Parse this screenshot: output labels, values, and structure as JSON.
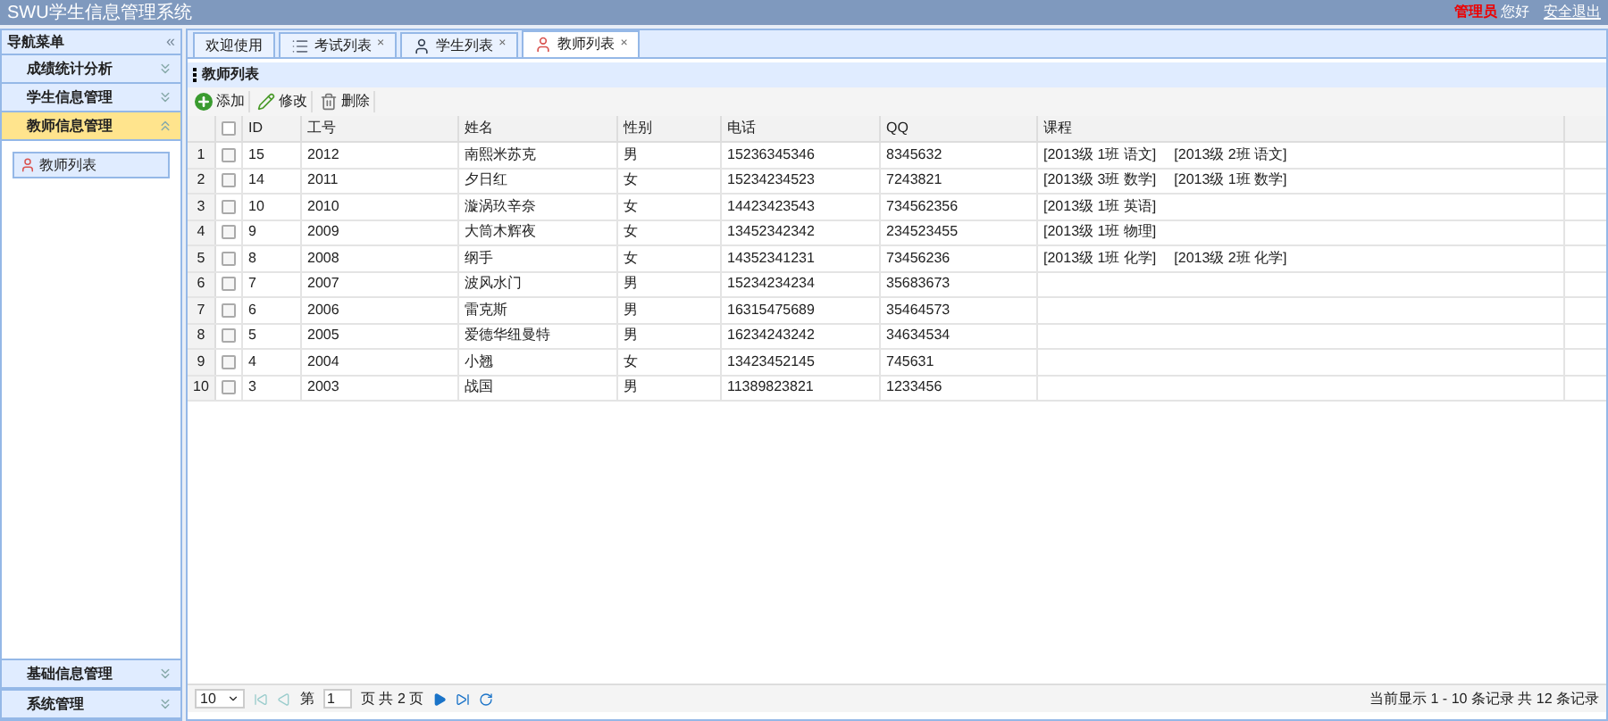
{
  "header": {
    "title": "SWU学生信息管理系统",
    "role": "管理员",
    "greeting": "您好",
    "logout": "安全退出"
  },
  "sidebar": {
    "title": "导航菜单",
    "collapse": "«",
    "items": [
      {
        "label": "成绩统计分析",
        "expanded": false
      },
      {
        "label": "学生信息管理",
        "expanded": false
      },
      {
        "label": "教师信息管理",
        "expanded": true,
        "children": [
          {
            "label": "教师列表"
          }
        ]
      }
    ],
    "bottom_items": [
      {
        "label": "基础信息管理",
        "expanded": false
      },
      {
        "label": "系统管理",
        "expanded": false
      }
    ]
  },
  "tabs": [
    {
      "label": "欢迎使用",
      "kind": "plain",
      "selected": false
    },
    {
      "label": "考试列表",
      "kind": "list",
      "close": "×",
      "selected": false
    },
    {
      "label": "学生列表",
      "kind": "student",
      "close": "×",
      "selected": false
    },
    {
      "label": "教师列表",
      "kind": "teacher",
      "close": "×",
      "selected": true
    }
  ],
  "panel": {
    "title": "教师列表"
  },
  "toolbar": [
    {
      "label": "添加",
      "kind": "add"
    },
    {
      "label": "修改",
      "kind": "edit"
    },
    {
      "label": "删除",
      "kind": "delete"
    }
  ],
  "table": {
    "all_checked": false,
    "columns": [
      "ID",
      "工号",
      "姓名",
      "性别",
      "电话",
      "QQ",
      "课程"
    ],
    "rows": [
      {
        "checked": false,
        "num": "1",
        "cells": [
          "15",
          "2012",
          "南熙米苏克",
          "男",
          "15236345346",
          "8345632"
        ],
        "courses": [
          "[2013级 1班 语文]",
          "[2013级 2班 语文]"
        ]
      },
      {
        "checked": false,
        "num": "2",
        "cells": [
          "14",
          "2011",
          "夕日红",
          "女",
          "15234234523",
          "7243821"
        ],
        "courses": [
          "[2013级 3班 数学]",
          "[2013级 1班 数学]"
        ]
      },
      {
        "checked": false,
        "num": "3",
        "cells": [
          "10",
          "2010",
          "漩涡玖辛奈",
          "女",
          "14423423543",
          "734562356"
        ],
        "courses": [
          "[2013级 1班 英语]"
        ]
      },
      {
        "checked": false,
        "num": "4",
        "cells": [
          "9",
          "2009",
          "大筒木辉夜",
          "女",
          "13452342342",
          "234523455"
        ],
        "courses": [
          "[2013级 1班 物理]"
        ]
      },
      {
        "checked": false,
        "num": "5",
        "cells": [
          "8",
          "2008",
          "纲手",
          "女",
          "14352341231",
          "73456236"
        ],
        "courses": [
          "[2013级 1班 化学]",
          "[2013级 2班 化学]"
        ]
      },
      {
        "checked": false,
        "num": "6",
        "cells": [
          "7",
          "2007",
          "波风水门",
          "男",
          "15234234234",
          "35683673"
        ],
        "courses": []
      },
      {
        "checked": false,
        "num": "7",
        "cells": [
          "6",
          "2006",
          "雷克斯",
          "男",
          "16315475689",
          "35464573"
        ],
        "courses": []
      },
      {
        "checked": false,
        "num": "8",
        "cells": [
          "5",
          "2005",
          "爱德华纽曼特",
          "男",
          "16234243242",
          "34634534"
        ],
        "courses": []
      },
      {
        "checked": false,
        "num": "9",
        "cells": [
          "4",
          "2004",
          "小翘",
          "女",
          "13423452145",
          "745631"
        ],
        "courses": []
      },
      {
        "checked": false,
        "num": "10",
        "cells": [
          "3",
          "2003",
          "战国",
          "男",
          "11389823821",
          "1233456"
        ],
        "courses": []
      }
    ]
  },
  "pager": {
    "page_size": "10",
    "page_prefix": "第",
    "page": "1",
    "page_suffix": "页 共 2 页",
    "summary": "当前显示 1 - 10 条记录 共 12 条记录"
  }
}
